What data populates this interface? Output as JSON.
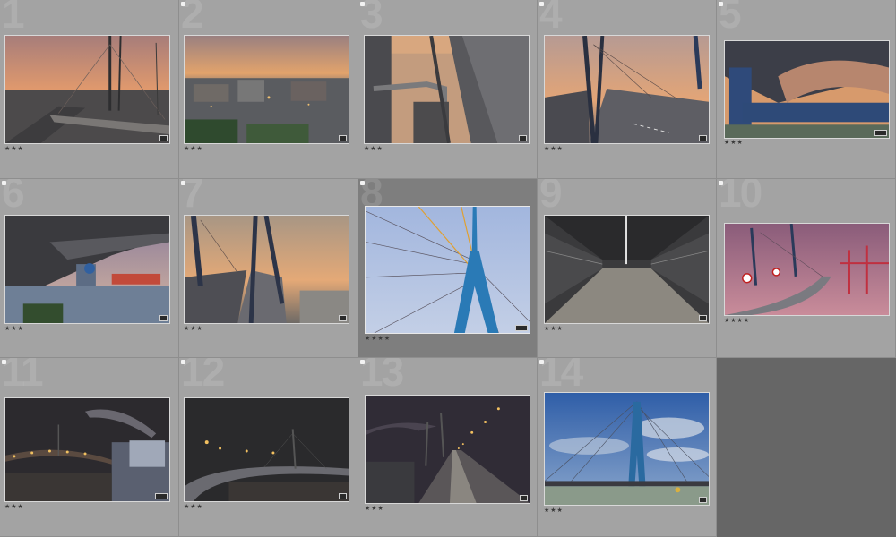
{
  "colors": {
    "cell_bg": "#a3a3a3",
    "selected_bg": "#7e7e7e",
    "empty_bg": "#666666"
  },
  "grid": {
    "selected_index": 8,
    "cells": [
      {
        "number": "1",
        "rating": "★★★",
        "flag": "",
        "subject": "bridge roadway at sunset"
      },
      {
        "number": "2",
        "rating": "★★★",
        "flag": "flagged",
        "subject": "harbor city at dusk"
      },
      {
        "number": "3",
        "rating": "★★★",
        "flag": "flagged",
        "subject": "bridge walkway pipes"
      },
      {
        "number": "4",
        "rating": "★★★",
        "flag": "flagged",
        "subject": "bridge road with pylon"
      },
      {
        "number": "5",
        "rating": "★★★",
        "flag": "flagged",
        "subject": "bridge underside"
      },
      {
        "number": "6",
        "rating": "★★★",
        "flag": "flagged",
        "subject": "under bridge harbor view"
      },
      {
        "number": "7",
        "rating": "★★★",
        "flag": "flagged",
        "subject": "bridge road pylon sunset"
      },
      {
        "number": "8",
        "rating": "★★★★",
        "flag": "flagged",
        "subject": "blue pylon with cables"
      },
      {
        "number": "9",
        "rating": "★★★",
        "flag": "",
        "subject": "enclosed bridge walkway"
      },
      {
        "number": "10",
        "rating": "★★★★",
        "flag": "flagged",
        "subject": "bridge with container cranes"
      },
      {
        "number": "11",
        "rating": "★★★",
        "flag": "flagged",
        "subject": "bridge at night with smoke"
      },
      {
        "number": "12",
        "rating": "★★★",
        "flag": "flagged",
        "subject": "curved bridge at night"
      },
      {
        "number": "13",
        "rating": "★★★",
        "flag": "flagged",
        "subject": "bridge roadway at night"
      },
      {
        "number": "14",
        "rating": "★★★",
        "flag": "flagged",
        "subject": "bridge under blue sky"
      }
    ]
  }
}
